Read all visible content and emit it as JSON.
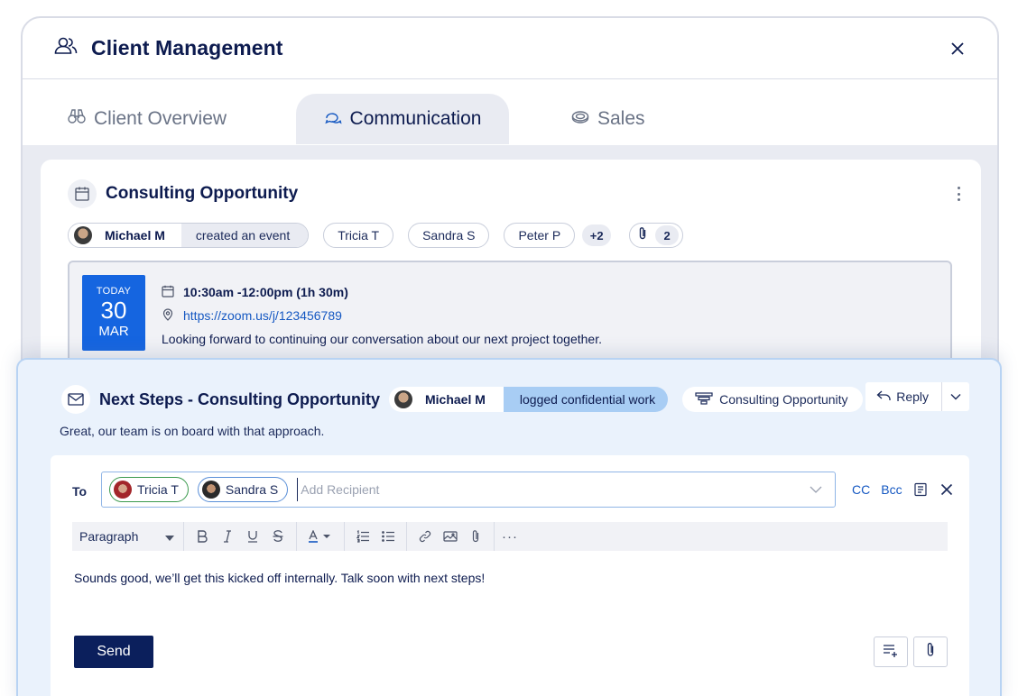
{
  "window": {
    "title": "Client Management"
  },
  "tabs": [
    {
      "label": "Client Overview",
      "icon": "binoculars-icon"
    },
    {
      "label": "Communication",
      "icon": "chat-bubbles-icon",
      "active": true
    },
    {
      "label": "Sales",
      "icon": "coins-icon"
    }
  ],
  "event_card": {
    "title": "Consulting Opportunity",
    "author": "Michael M",
    "action": "created an event",
    "participants": [
      "Tricia T",
      "Sandra S",
      "Peter P"
    ],
    "more_participants": "+2",
    "attachment_count": "2",
    "date": {
      "label": "TODAY",
      "day": "30",
      "month": "MAR"
    },
    "time": "10:30am -12:00pm  (1h 30m)",
    "link": "https://zoom.us/j/123456789",
    "description": "Looking forward to continuing our conversation about our next project together."
  },
  "email": {
    "subject": "Next Steps - Consulting Opportunity",
    "author": "Michael M",
    "action": "logged confidential work",
    "opportunity": "Consulting Opportunity",
    "reply_label": "Reply",
    "body": "Great, our team is on board with that approach."
  },
  "compose": {
    "to_label": "To",
    "recipients": [
      "Tricia T",
      "Sandra S"
    ],
    "add_placeholder": "Add Recipient",
    "cc_label": "CC",
    "bcc_label": "Bcc",
    "paragraph_style": "Paragraph",
    "text": "Sounds good, we’ll get this kicked off internally. Talk soon with next steps!",
    "send_label": "Send"
  },
  "colors": {
    "primary_dark": "#0b1f5c",
    "accent_blue": "#1565e0",
    "panel_bg": "#eaf2fc",
    "log_chip": "#a8cdf4"
  }
}
